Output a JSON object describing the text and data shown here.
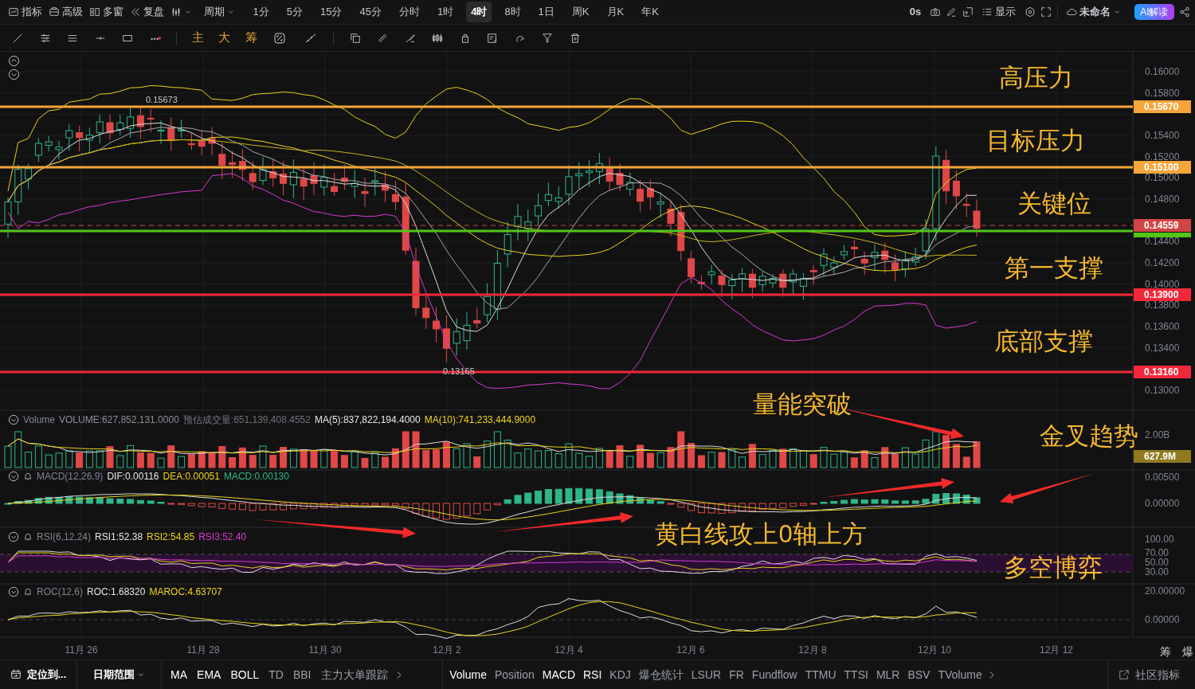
{
  "top_bar": {
    "menu": [
      {
        "label": "指标"
      },
      {
        "label": "高级"
      },
      {
        "label": "多窗"
      },
      {
        "label": "复盘"
      }
    ],
    "period_menu": "周期",
    "periods": [
      {
        "label": "1分",
        "selected": false
      },
      {
        "label": "5分",
        "selected": false
      },
      {
        "label": "15分",
        "selected": false
      },
      {
        "label": "45分",
        "selected": false
      },
      {
        "label": "分时",
        "selected": false
      },
      {
        "label": "1时",
        "selected": false
      },
      {
        "label": "4时",
        "selected": true
      },
      {
        "label": "8时",
        "selected": false
      },
      {
        "label": "1日",
        "selected": false
      },
      {
        "label": "周K",
        "selected": false
      },
      {
        "label": "月K",
        "selected": false
      },
      {
        "label": "年K",
        "selected": false
      }
    ],
    "timer": "0s",
    "display": "显示",
    "layout_name": "未命名",
    "ai_button": "AI解读"
  },
  "drawing_toolbar": {
    "labels": [
      "主",
      "大",
      "筹"
    ]
  },
  "chart": {
    "high_mark": "0.15673",
    "low_mark": "0.13165",
    "price_ticks": [
      "0.16000",
      "0.15800",
      "0.15400",
      "0.15200",
      "0.15000",
      "0.14800",
      "0.14400",
      "0.14200",
      "0.14000",
      "0.13800",
      "0.13600",
      "0.13400",
      "0.13000"
    ],
    "levels": [
      {
        "label": "0.15670",
        "color": "#f5a53a",
        "kind": "solid"
      },
      {
        "label": "0.15100",
        "color": "#f5a53a",
        "kind": "solid"
      },
      {
        "label": "0.14559",
        "color": "#d24545",
        "kind": "dashed"
      },
      {
        "color": "#52c41a",
        "kind": "solid"
      },
      {
        "label": "0.13900",
        "color": "#f0283a",
        "kind": "solid"
      },
      {
        "label": "0.13160",
        "color": "#f0283a",
        "kind": "solid"
      }
    ],
    "annotations": [
      "高压力",
      "目标压力",
      "关键位",
      "第一支撑",
      "底部支撑",
      "量能突破",
      "金叉趋势",
      "黄白线攻上0轴上方",
      "多空博弈"
    ]
  },
  "panes": [
    {
      "kind": "volume",
      "title": "Volume",
      "values": [
        {
          "text": "VOLUME:627,852,131.0000",
          "color": "#8a8f98"
        },
        {
          "text": "预估成交量:651,139,408.4552",
          "color": "#6f747c"
        },
        {
          "text": "MA(5):837,822,194.4000",
          "color": "#e6e6e6"
        },
        {
          "text": "MA(10):741,233,444.9000",
          "color": "#f0d31a"
        }
      ],
      "axis": [
        "2.00B"
      ],
      "tag": "627.9M"
    },
    {
      "kind": "macd",
      "title": "MACD(12,26,9)",
      "values": [
        {
          "text": "DIF:0.00116",
          "color": "#e6e6e6"
        },
        {
          "text": "DEA:0.00051",
          "color": "#f0d31a"
        },
        {
          "text": "MACD:0.00130",
          "color": "#2fb58a"
        }
      ],
      "axis": [
        "0.00500",
        "0.00000"
      ]
    },
    {
      "kind": "rsi",
      "title": "RSI(6,12,24)",
      "values": [
        {
          "text": "RSI1:52.38",
          "color": "#e6e6e6"
        },
        {
          "text": "RSI2:54.85",
          "color": "#f0d31a"
        },
        {
          "text": "RSI3:52.40",
          "color": "#d63bd0"
        }
      ],
      "axis": [
        "100.00",
        "70.00",
        "50.00",
        "30.00"
      ]
    },
    {
      "kind": "roc",
      "title": "ROC(12,6)",
      "values": [
        {
          "text": "ROC:1.68320",
          "color": "#e6e6e6"
        },
        {
          "text": "MAROC:4.63707",
          "color": "#f0d31a"
        }
      ],
      "axis": [
        "20.00000",
        "0.00000"
      ]
    }
  ],
  "date_axis": [
    "11月 26",
    "11月 28",
    "11月 30",
    "12月 2",
    "12月 4",
    "12月 6",
    "12月 8",
    "12月 10",
    "12月 12"
  ],
  "corner_labels": [
    "筹",
    "爆"
  ],
  "bottom_bar": {
    "locate": "定位到...",
    "date_range": "日期范围",
    "main_indicators": [
      {
        "label": "MA",
        "active": true
      },
      {
        "label": "EMA",
        "active": true
      },
      {
        "label": "BOLL",
        "active": true
      },
      {
        "label": "TD",
        "active": false
      },
      {
        "label": "BBI",
        "active": false
      },
      {
        "label": "主力大单跟踪",
        "active": false
      }
    ],
    "sub_indicators": [
      {
        "label": "Volume",
        "active": true
      },
      {
        "label": "Position",
        "active": false
      },
      {
        "label": "MACD",
        "active": true
      },
      {
        "label": "RSI",
        "active": true
      },
      {
        "label": "KDJ",
        "active": false
      },
      {
        "label": "爆仓统计",
        "active": false
      },
      {
        "label": "LSUR",
        "active": false
      },
      {
        "label": "FR",
        "active": false
      },
      {
        "label": "Fundflow",
        "active": false
      },
      {
        "label": "TTMU",
        "active": false
      },
      {
        "label": "TTSI",
        "active": false
      },
      {
        "label": "MLR",
        "active": false
      },
      {
        "label": "BSV",
        "active": false
      },
      {
        "label": "TVolume",
        "active": false
      }
    ],
    "community": "社区指标"
  }
}
